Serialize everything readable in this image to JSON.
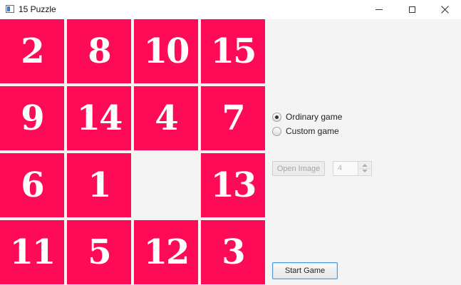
{
  "window": {
    "title": "15 Puzzle",
    "icon": "app-window-icon"
  },
  "board": {
    "tiles": [
      [
        "2",
        "8",
        "10",
        "15"
      ],
      [
        "9",
        "14",
        "4",
        "7"
      ],
      [
        "6",
        "1",
        "",
        "13"
      ],
      [
        "11",
        "5",
        "12",
        "3"
      ]
    ],
    "tile_color": "#fd0b56"
  },
  "controls": {
    "mode_ordinary": "Ordinary game",
    "mode_custom": "Custom game",
    "selected_mode": "Ordinary game",
    "open_image": "Open Image",
    "size_value": "4",
    "start_game": "Start Game"
  }
}
